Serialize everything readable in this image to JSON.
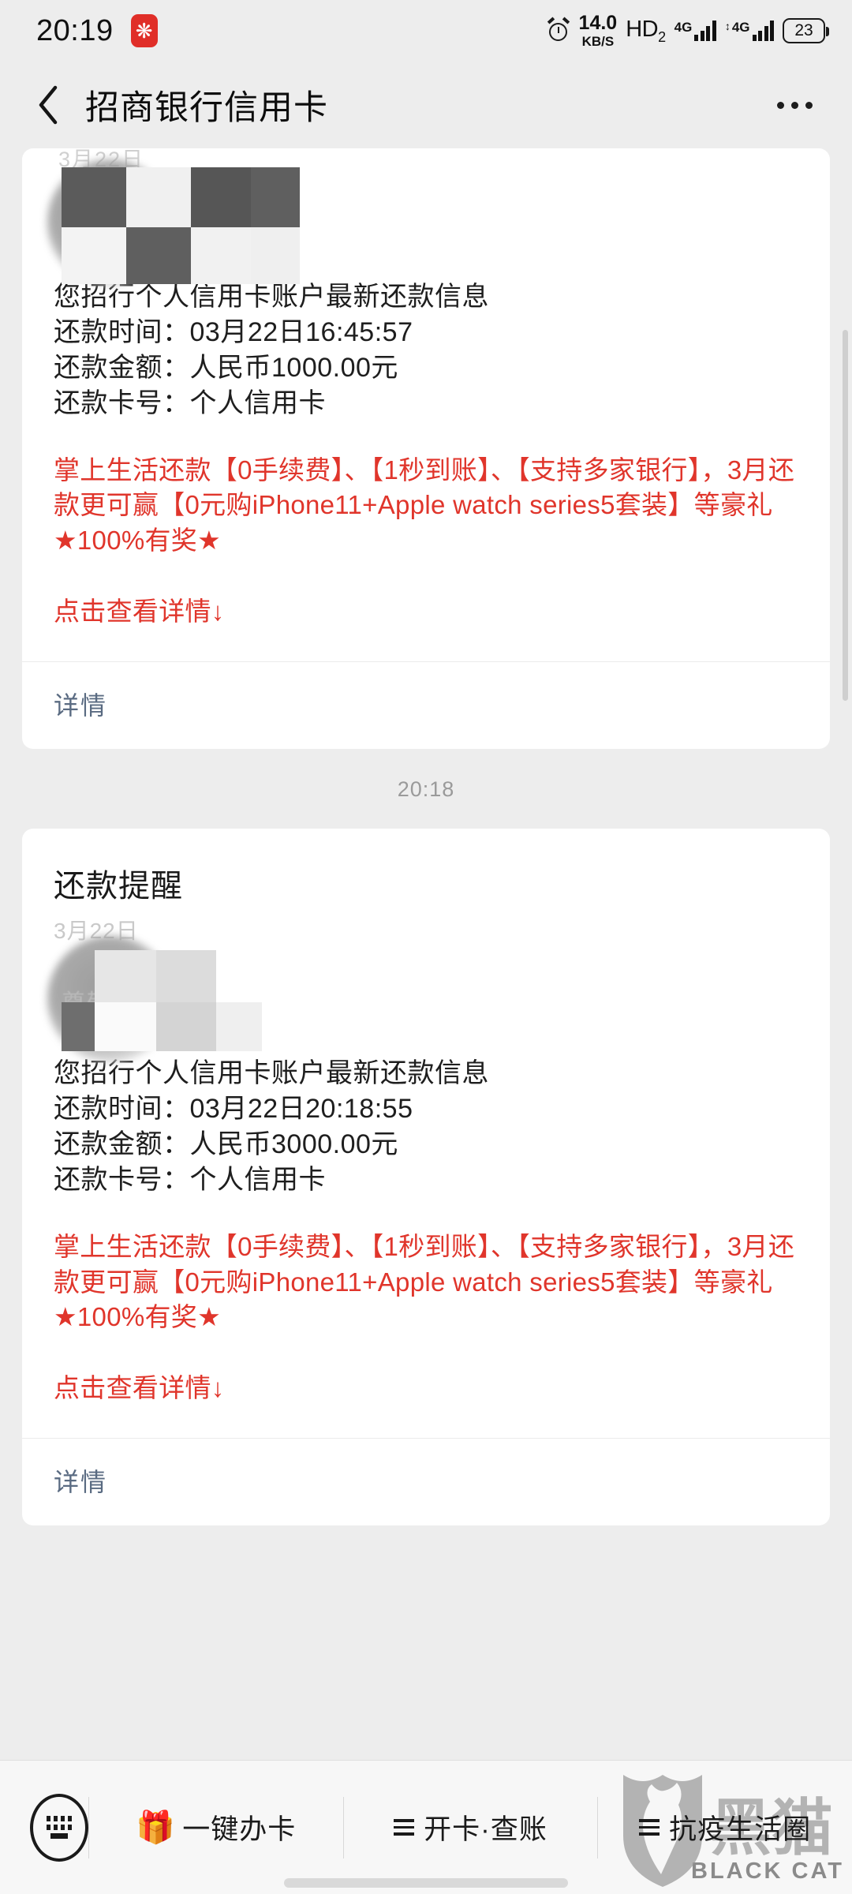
{
  "status_bar": {
    "time": "20:19",
    "app_badge_icon": "flower-badge-icon",
    "alarm_icon": "alarm-clock-icon",
    "net_speed_value": "14.0",
    "net_speed_unit": "KB/S",
    "hd_label": "HD",
    "hd_sub": "2",
    "sim1_label": "4G",
    "sim2_label": "4G",
    "sim2_prefix": "↕",
    "battery_level": "23"
  },
  "nav": {
    "back_icon": "chevron-left-icon",
    "title": "招商银行信用卡",
    "more_icon": "more-dots-icon"
  },
  "messages": [
    {
      "date_hint": "3月22日",
      "ghost_text": "",
      "title": "",
      "lines": [
        "您招行个人信用卡账户最新还款信息",
        "还款时间：03月22日16:45:57",
        "还款金额：人民币1000.00元",
        "还款卡号：个人信用卡"
      ],
      "promo": "掌上生活还款【0手续费】、【1秒到账】、【支持多家银行】，3月还款更可赢【0元购iPhone11+Apple watch series5套装】等豪礼★100%有奖★",
      "cta": "点击查看详情↓",
      "footer_link": "详情"
    },
    {
      "date_hint": "3月22日",
      "ghost_text": "尊敬的",
      "title": "还款提醒",
      "lines": [
        "您招行个人信用卡账户最新还款信息",
        "还款时间：03月22日20:18:55",
        "还款金额：人民币3000.00元",
        "还款卡号：个人信用卡"
      ],
      "promo": "掌上生活还款【0手续费】、【1秒到账】、【支持多家银行】，3月还款更可赢【0元购iPhone11+Apple watch series5套装】等豪礼★100%有奖★",
      "cta": "点击查看详情↓",
      "footer_link": "详情"
    }
  ],
  "separator_timestamp": "20:18",
  "bottom_bar": {
    "keyboard_icon": "keyboard-icon",
    "items": [
      {
        "icon": "gift-icon",
        "glyph": "🎁",
        "label": "一键办卡"
      },
      {
        "icon": "menu-icon",
        "glyph": "",
        "label": "开卡·查账"
      },
      {
        "icon": "menu-icon",
        "glyph": "",
        "label": "抗疫生活圈"
      }
    ]
  },
  "watermark": {
    "brand_cn": "黑猫",
    "brand_en": "BLACK CAT"
  },
  "colors": {
    "promo_red": "#e0352b",
    "link_slate": "#5a6b82",
    "page_bg": "#ededed",
    "card_bg": "#ffffff"
  }
}
